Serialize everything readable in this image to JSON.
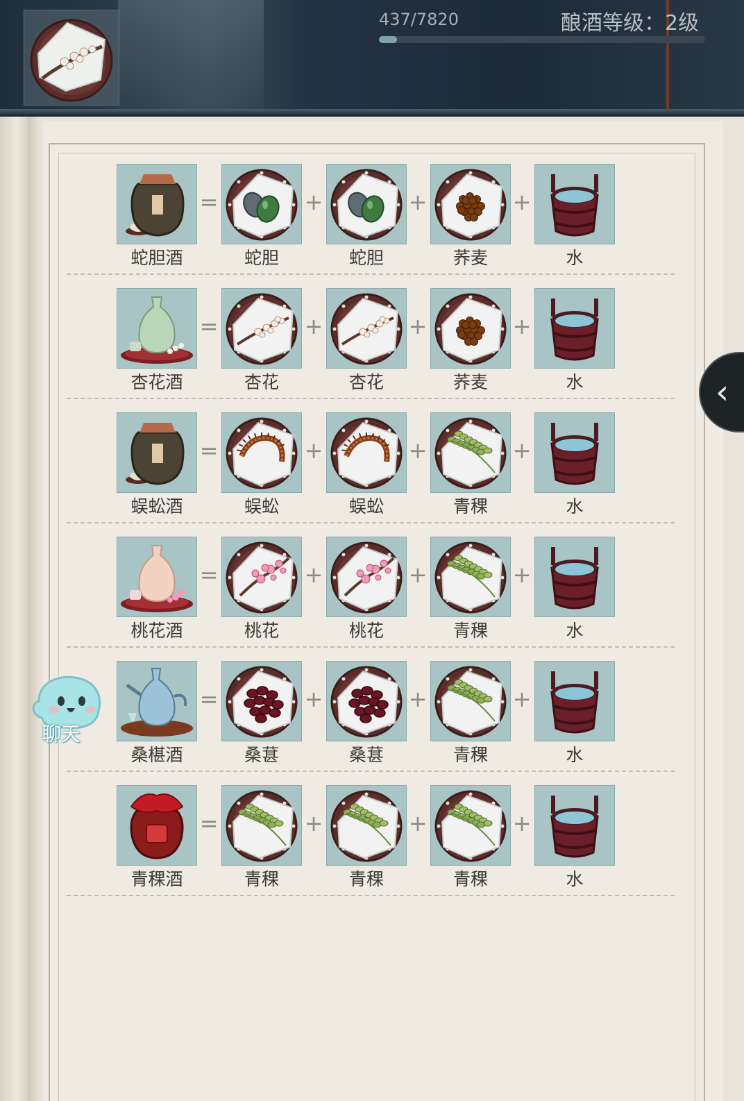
{
  "header": {
    "progress_text": "437/7820",
    "progress_value": 437,
    "progress_max": 7820,
    "level_text": "酿酒等级：2级",
    "avatar_icon": "apricot-blossom-plate-icon"
  },
  "recipes": [
    {
      "result": "蛇胆酒",
      "result_icon": "snake-gall-wine-jar-icon",
      "ingredients": [
        "蛇胆",
        "蛇胆",
        "荞麦",
        "水"
      ]
    },
    {
      "result": "杏花酒",
      "result_icon": "apricot-wine-bottle-icon",
      "ingredients": [
        "杏花",
        "杏花",
        "荞麦",
        "水"
      ]
    },
    {
      "result": "蜈蚣酒",
      "result_icon": "centipede-wine-jar-icon",
      "ingredients": [
        "蜈蚣",
        "蜈蚣",
        "青稞",
        "水"
      ]
    },
    {
      "result": "桃花酒",
      "result_icon": "peach-wine-bottle-icon",
      "ingredients": [
        "桃花",
        "桃花",
        "青稞",
        "水"
      ]
    },
    {
      "result": "桑椹酒",
      "result_icon": "mulberry-wine-ewer-icon",
      "ingredients": [
        "桑葚",
        "桑葚",
        "青稞",
        "水"
      ]
    },
    {
      "result": "青稞酒",
      "result_icon": "barley-wine-jar-icon",
      "ingredients": [
        "青稞",
        "青稞",
        "青稞",
        "水"
      ]
    }
  ],
  "operators": {
    "equals": "=",
    "plus": "+"
  },
  "side_tab": {
    "icon": "chevron-left-icon",
    "glyph": "‹"
  },
  "chat": {
    "label": "聊天",
    "icon": "ghost-chat-icon"
  },
  "colors": {
    "slot_bg": "#a9c4c4",
    "page_bg": "#efebe3",
    "label": "#3b3a36"
  }
}
